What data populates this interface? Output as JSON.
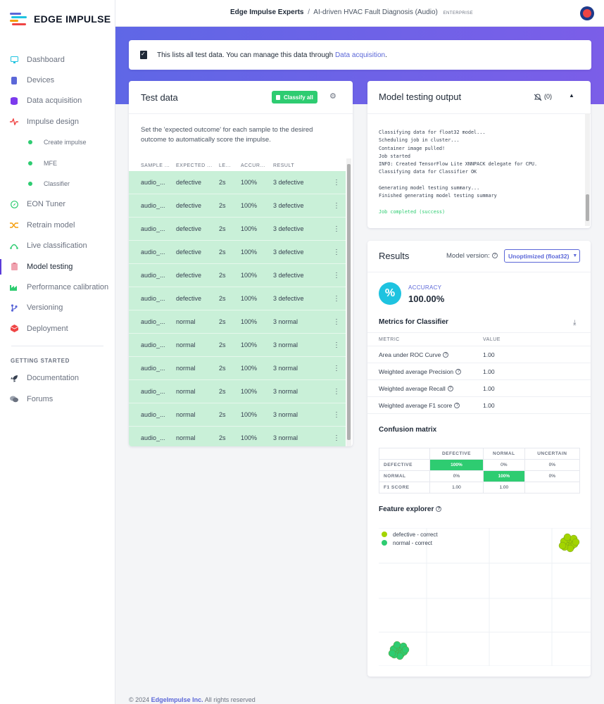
{
  "app": {
    "logo_text": "EDGE IMPULSE"
  },
  "sidebar": {
    "items": [
      {
        "label": "Dashboard",
        "icon": "monitor-icon"
      },
      {
        "label": "Devices",
        "icon": "device-icon"
      },
      {
        "label": "Data acquisition",
        "icon": "database-icon"
      },
      {
        "label": "Impulse design",
        "icon": "pulse-icon"
      }
    ],
    "sub_items": [
      {
        "label": "Create impulse"
      },
      {
        "label": "MFE"
      },
      {
        "label": "Classifier"
      }
    ],
    "items2": [
      {
        "label": "EON Tuner",
        "icon": "compass-icon"
      },
      {
        "label": "Retrain model",
        "icon": "shuffle-icon"
      },
      {
        "label": "Live classification",
        "icon": "live-icon"
      },
      {
        "label": "Model testing",
        "icon": "clipboard-icon",
        "active": true
      },
      {
        "label": "Performance calibration",
        "icon": "factory-icon"
      },
      {
        "label": "Versioning",
        "icon": "branch-icon"
      },
      {
        "label": "Deployment",
        "icon": "cube-icon"
      }
    ],
    "section_title": "GETTING STARTED",
    "getting_started": [
      {
        "label": "Documentation",
        "icon": "rocket-icon"
      },
      {
        "label": "Forums",
        "icon": "chat-icon"
      }
    ]
  },
  "header": {
    "org": "Edge Impulse Experts",
    "separator": "/",
    "project": "AI-driven HVAC Fault Diagnosis (Audio)",
    "badge": "ENTERPRISE"
  },
  "info": {
    "text": "This lists all test data. You can manage this data through ",
    "link": "Data acquisition",
    "suffix": "."
  },
  "test_data": {
    "title": "Test data",
    "classify_label": "Classify all",
    "help": "Set the 'expected outcome' for each sample to the desired outcome to automatically score the impulse.",
    "columns": [
      "SAMPLE ...",
      "EXPECTED ...",
      "LE...",
      "ACCUR...",
      "RESULT"
    ],
    "rows": [
      {
        "sample": "audio_...",
        "expected": "defective",
        "length": "2s",
        "accuracy": "100%",
        "result": "3 defective"
      },
      {
        "sample": "audio_...",
        "expected": "defective",
        "length": "2s",
        "accuracy": "100%",
        "result": "3 defective"
      },
      {
        "sample": "audio_...",
        "expected": "defective",
        "length": "2s",
        "accuracy": "100%",
        "result": "3 defective"
      },
      {
        "sample": "audio_...",
        "expected": "defective",
        "length": "2s",
        "accuracy": "100%",
        "result": "3 defective"
      },
      {
        "sample": "audio_...",
        "expected": "defective",
        "length": "2s",
        "accuracy": "100%",
        "result": "3 defective"
      },
      {
        "sample": "audio_...",
        "expected": "defective",
        "length": "2s",
        "accuracy": "100%",
        "result": "3 defective"
      },
      {
        "sample": "audio_...",
        "expected": "normal",
        "length": "2s",
        "accuracy": "100%",
        "result": "3 normal"
      },
      {
        "sample": "audio_...",
        "expected": "normal",
        "length": "2s",
        "accuracy": "100%",
        "result": "3 normal"
      },
      {
        "sample": "audio_...",
        "expected": "normal",
        "length": "2s",
        "accuracy": "100%",
        "result": "3 normal"
      },
      {
        "sample": "audio_...",
        "expected": "normal",
        "length": "2s",
        "accuracy": "100%",
        "result": "3 normal"
      },
      {
        "sample": "audio_...",
        "expected": "normal",
        "length": "2s",
        "accuracy": "100%",
        "result": "3 normal"
      },
      {
        "sample": "audio_...",
        "expected": "normal",
        "length": "2s",
        "accuracy": "100%",
        "result": "3 normal"
      }
    ]
  },
  "output": {
    "title": "Model testing output",
    "count": "(0)",
    "log": [
      "Classifying data for float32 model...",
      "Scheduling job in cluster...",
      "Container image pulled!",
      "Job started",
      "INFO: Created TensorFlow Lite XNNPACK delegate for CPU.",
      "Classifying data for Classifier OK",
      "",
      "Generating model testing summary...",
      "Finished generating model testing summary",
      ""
    ],
    "success": "Job completed (success)"
  },
  "results": {
    "title": "Results",
    "model_version_label": "Model version:",
    "model_version": "Unoptimized (float32)",
    "accuracy_label": "ACCURACY",
    "accuracy_value": "100.00%",
    "metrics_title": "Metrics for Classifier",
    "metric_header": "METRIC",
    "value_header": "VALUE",
    "metrics": [
      {
        "name": "Area under ROC Curve",
        "value": "1.00"
      },
      {
        "name": "Weighted average Precision",
        "value": "1.00"
      },
      {
        "name": "Weighted average Recall",
        "value": "1.00"
      },
      {
        "name": "Weighted average F1 score",
        "value": "1.00"
      }
    ],
    "confusion_title": "Confusion matrix",
    "confusion": {
      "columns": [
        "DEFECTIVE",
        "NORMAL",
        "UNCERTAIN"
      ],
      "rows": [
        {
          "label": "DEFECTIVE",
          "cells": [
            "100%",
            "0%",
            "0%"
          ]
        },
        {
          "label": "NORMAL",
          "cells": [
            "0%",
            "100%",
            "0%"
          ]
        },
        {
          "label": "F1 SCORE",
          "cells": [
            "1.00",
            "1.00",
            ""
          ]
        }
      ]
    },
    "feature_title": "Feature explorer",
    "legend": [
      {
        "label": "defective - correct",
        "color": "#a3d400"
      },
      {
        "label": "normal - correct",
        "color": "#2ecc71"
      }
    ]
  },
  "footer": {
    "prefix": "© 2024 ",
    "link": "EdgeImpulse Inc.",
    "suffix": " All rights reserved"
  },
  "colors": {
    "accent": "#5b67d8",
    "success": "#2ecc71",
    "row_bg": "#c9f0d8"
  }
}
